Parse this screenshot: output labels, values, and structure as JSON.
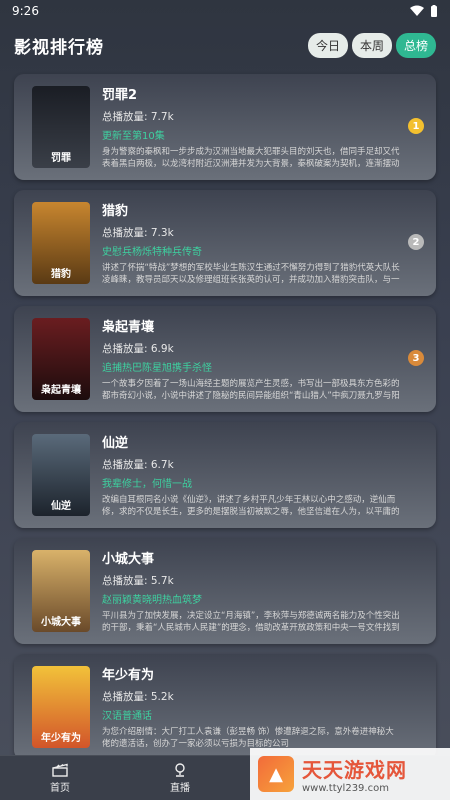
{
  "status": {
    "time": "9:26"
  },
  "header": {
    "title": "影视排行榜",
    "tabs": [
      "今日",
      "本周",
      "总榜"
    ],
    "active_tab": 2
  },
  "items": [
    {
      "title": "罚罪2",
      "plays": "总播放量: 7.7k",
      "highlight": "更新至第10集",
      "desc": "身为警察的秦枫和一步步成为汉洲当地最大犯罪头目的刘天也，借同手足却又代表着黑白两极，以龙湾村附近汉洲港并发为大背景，秦枫破案为契机，连渐摆动",
      "rank": "1",
      "poster_text": "罚罪",
      "poster_colors": [
        "#1a1d24",
        "#3a3f48"
      ],
      "rank_color": "#f3c02f"
    },
    {
      "title": "猎豹",
      "plays": "总播放量: 7.3k",
      "highlight": "史慰兵杨烁特种兵传奇",
      "desc": "讲述了怀揣“特战”梦想的军校毕业生陈汉生通过不懈努力得到了猎豹代英大队长凌峰睐，教导员邱天以及修理组班长张英的认可，并成功加入猎豹突击队，与一众",
      "rank": "2",
      "poster_text": "猎豹",
      "poster_colors": [
        "#c8862f",
        "#5a3a14"
      ],
      "rank_color": "#b9b9b9"
    },
    {
      "title": "枭起青壤",
      "plays": "总播放量: 6.9k",
      "highlight": "追捕热巴陈星旭携手杀怪",
      "desc": "一个故事夕因着了一场山海经主题的展览产生灵感，书写出一部极具东方色彩的都市奇幻小说，小说中讲述了隐秘的民间异能组织“青山猎人”中疯刀聂九罗与阳光",
      "rank": "3",
      "poster_text": "枭起青壤",
      "poster_colors": [
        "#6a1d20",
        "#1c0c0d"
      ],
      "rank_color": "#d98a3a"
    },
    {
      "title": "仙逆",
      "plays": "总播放量: 6.7k",
      "highlight": "我辈修士，何惜一战",
      "desc": "改编自耳根同名小说《仙逆》，讲述了乡村平凡少年王林以心中之感动，逆仙而修，求的不仅是长生，更多的是摆脱当初被欺之辱，他坚信道在人为，以平庸的资质踏入修",
      "rank": "",
      "poster_text": "仙逆",
      "poster_colors": [
        "#5a6a7a",
        "#1c232c"
      ],
      "rank_color": ""
    },
    {
      "title": "小城大事",
      "plays": "总播放量: 5.7k",
      "highlight": "赵丽颖黄晓明热血筑梦",
      "desc": "平川县为了加快发展，决定设立“月海镇”，李秋萍与郑德诚两名能力及个性突出的干部，秉着“人民城市人民建”的理念，借助改革开放政策和中央一号文件找到了改革的办法，",
      "rank": "",
      "poster_text": "小城大事",
      "poster_colors": [
        "#d9b26a",
        "#6a4a2a"
      ],
      "rank_color": ""
    },
    {
      "title": "年少有为",
      "plays": "总播放量: 5.2k",
      "highlight": "汉语普通话",
      "desc": "为您介绍剧情：大厂打工人袁谦（彭昱畅 饰）惨遭辞退之际，意外卷进神秘大佬的遗活话，创办了一家必须以亏损为目标的公司",
      "rank": "",
      "poster_text": "年少有为",
      "poster_colors": [
        "#f2c23a",
        "#d2552a"
      ],
      "rank_color": ""
    }
  ],
  "nav": [
    {
      "label": "首页",
      "icon": "clapperboard-icon"
    },
    {
      "label": "直播",
      "icon": "live-icon"
    }
  ],
  "watermark": {
    "title": "天天游戏网",
    "url": "www.ttyl239.com"
  }
}
